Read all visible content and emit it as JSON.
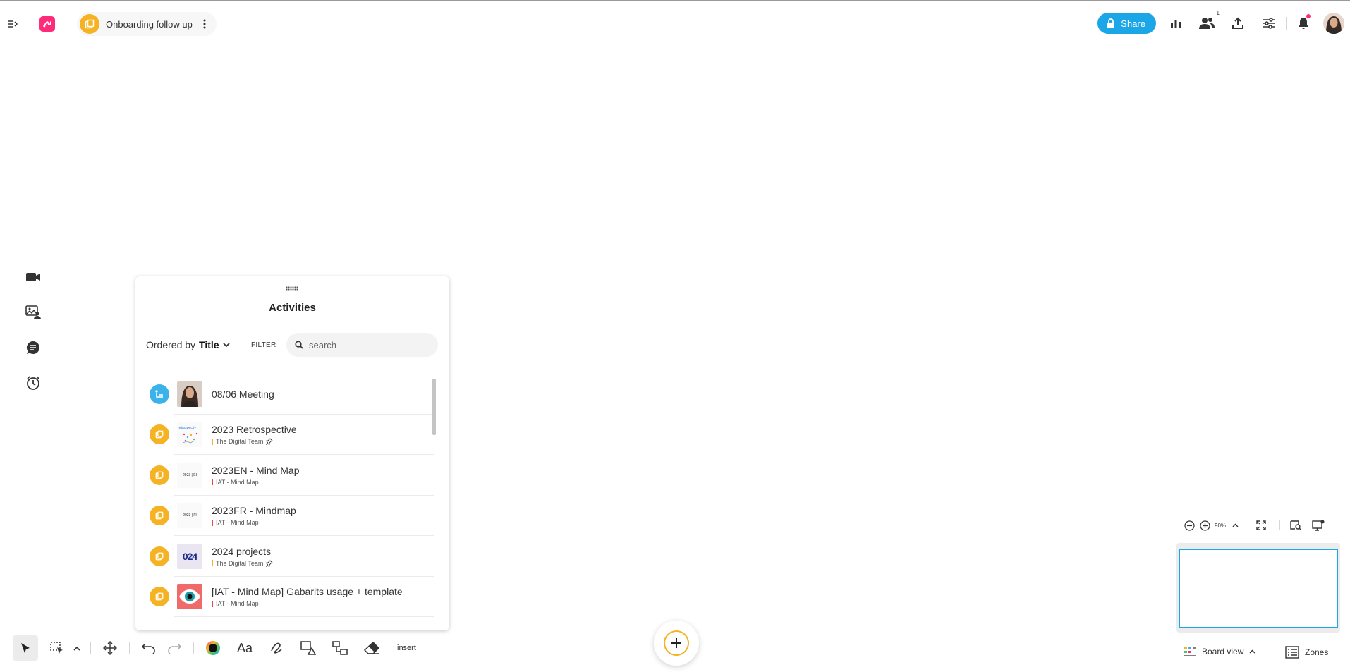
{
  "header": {
    "board_title": "Onboarding follow up",
    "share_label": "Share",
    "participants_count": "1",
    "colors": {
      "brand": "#ff2a7a",
      "accent": "#1aa6e7",
      "board": "#f5b324",
      "notification_dot": "#ff2a7a"
    }
  },
  "left_rail": {
    "icons": [
      "video-icon",
      "image-people-icon",
      "chat-icon",
      "timer-icon"
    ]
  },
  "activities": {
    "title": "Activities",
    "ordered_by_prefix": "Ordered by",
    "ordered_by_value": "Title",
    "filter_label": "FILTER",
    "search_placeholder": "search",
    "items": [
      {
        "title": "08/06 Meeting",
        "subtitle": "",
        "icon": "list-icon"
      },
      {
        "title": "2023 Retrospective",
        "subtitle": "The Digital Team",
        "icon": "board-icon",
        "tag_color": "#f5b324",
        "pinned": true
      },
      {
        "title": "2023EN - Mind Map",
        "subtitle": "IAT - Mind Map",
        "icon": "board-icon",
        "tag_color": "#e8474e",
        "thumb_text": "2023 | EI"
      },
      {
        "title": "2023FR - Mindmap",
        "subtitle": "IAT - Mind Map",
        "icon": "board-icon",
        "tag_color": "#e8474e",
        "thumb_text": "2023 | FI"
      },
      {
        "title": "2024 projects",
        "subtitle": "The Digital Team",
        "icon": "board-icon",
        "tag_color": "#f5b324",
        "pinned": true,
        "thumb_text": "024"
      },
      {
        "title": "[IAT - Mind Map] Gabarits usage + template",
        "subtitle": "IAT - Mind Map",
        "icon": "board-icon",
        "tag_color": "#e8474e"
      }
    ]
  },
  "toolbar": {
    "insert_label": "insert"
  },
  "zoom": {
    "level": "90%"
  },
  "footer": {
    "board_view_label": "Board view",
    "zones_label": "Zones"
  }
}
